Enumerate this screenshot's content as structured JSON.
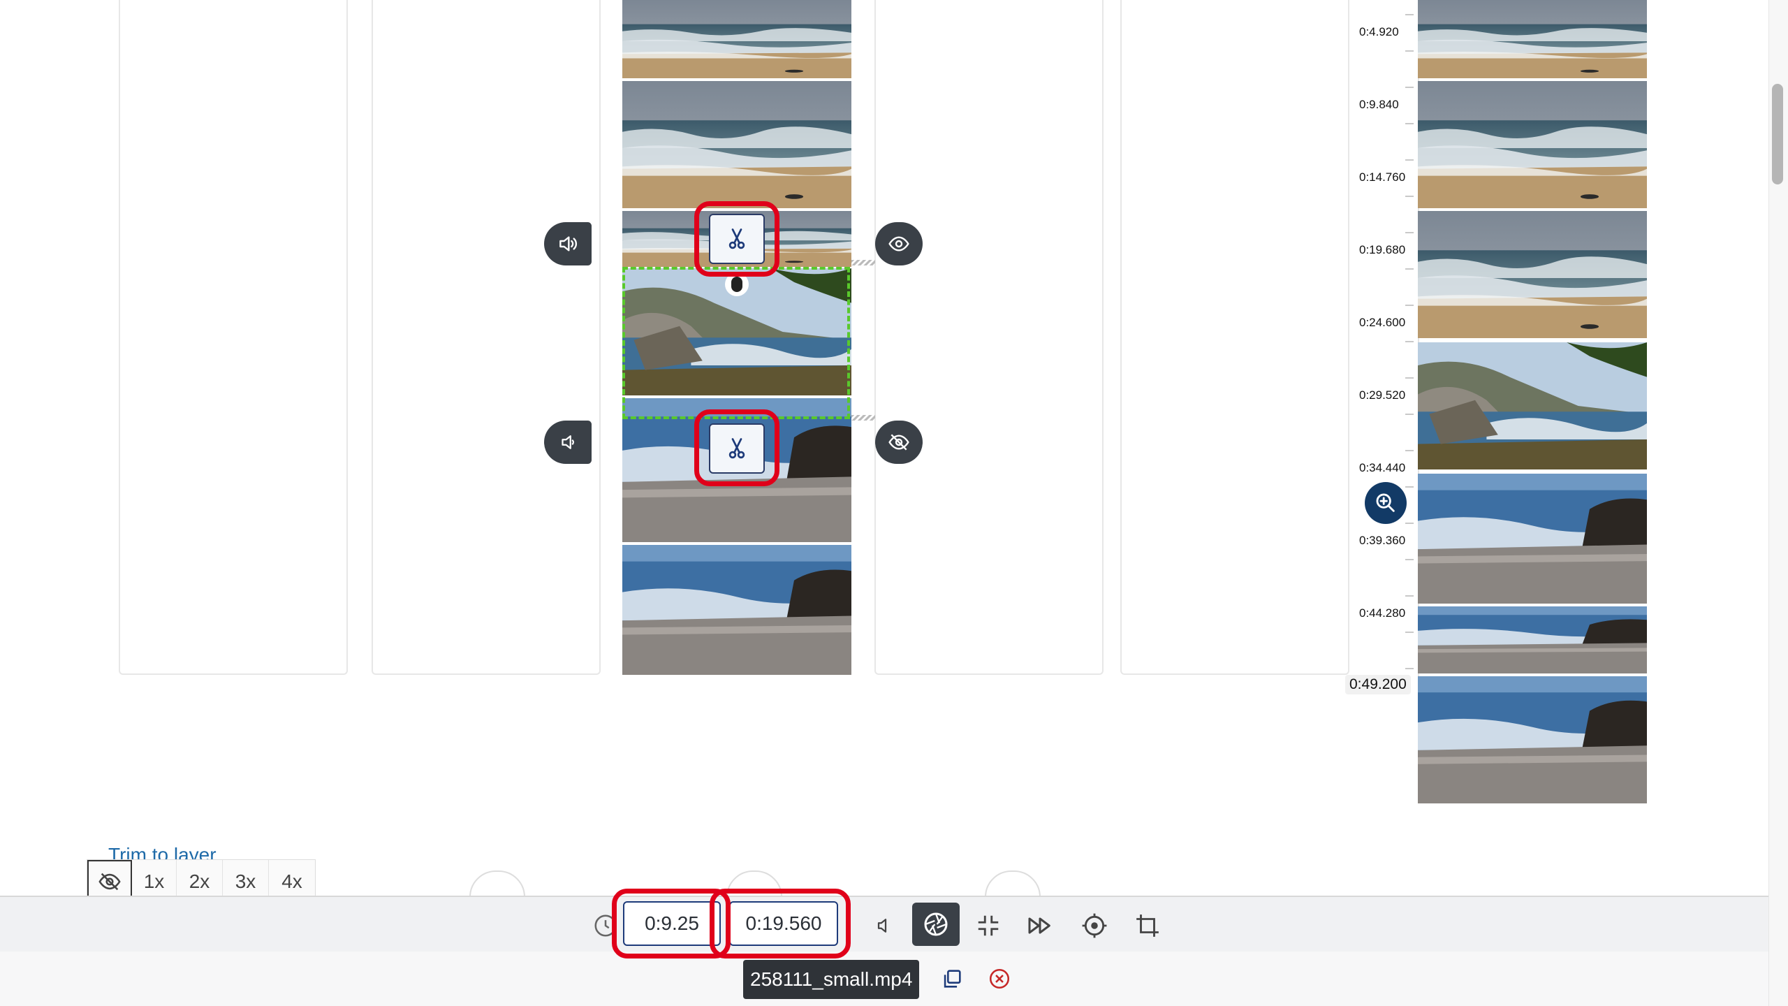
{
  "trim_link": "Trim to layer",
  "speed_options": [
    "1x",
    "2x",
    "3x",
    "4x"
  ],
  "start_time": "0:9.25",
  "end_time": "0:19.560",
  "file_name": "258111_small.mp4",
  "ruler_labels": [
    "0:4.920",
    "0:9.840",
    "0:14.760",
    "0:19.680",
    "0:24.600",
    "0:29.520",
    "0:34.440",
    "0:39.360",
    "0:44.280"
  ],
  "ruler_end_label": "0:49.200",
  "icons": {
    "volume_high": "volume-high-icon",
    "volume_low": "volume-low-icon",
    "eye": "eye-icon",
    "eye_off": "eye-off-icon",
    "scissors": "scissors-icon",
    "zoom_in": "zoom-in-icon",
    "clock": "clock-icon",
    "speaker": "speaker-icon",
    "aperture": "aperture-icon",
    "shrink": "shrink-icon",
    "fast_forward": "fast-forward-icon",
    "target": "target-icon",
    "crop": "crop-icon",
    "copy": "copy-icon",
    "close": "close-circle-icon",
    "hidden": "eye-off-icon"
  },
  "colors": {
    "highlight_red": "#e0001a",
    "selection_green": "#59c92c",
    "dark_button": "#3a4047",
    "accent_blue": "#1e3b7a",
    "zoom_button": "#123a66"
  }
}
